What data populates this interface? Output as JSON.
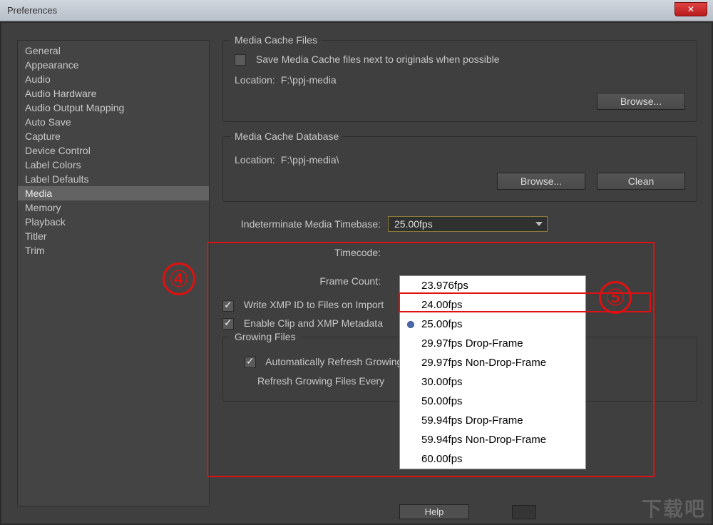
{
  "window": {
    "title": "Preferences"
  },
  "sidebar": {
    "items": [
      "General",
      "Appearance",
      "Audio",
      "Audio Hardware",
      "Audio Output Mapping",
      "Auto Save",
      "Capture",
      "Device Control",
      "Label Colors",
      "Label Defaults",
      "Media",
      "Memory",
      "Playback",
      "Titler",
      "Trim"
    ],
    "selected_index": 10
  },
  "media_cache_files": {
    "title": "Media Cache Files",
    "save_next_label": "Save Media Cache files next to originals when possible",
    "save_next_checked": false,
    "location_label": "Location:",
    "location_value": "F:\\ppj-media",
    "browse_label": "Browse..."
  },
  "media_cache_db": {
    "title": "Media Cache Database",
    "location_label": "Location:",
    "location_value": "F:\\ppj-media\\",
    "browse_label": "Browse...",
    "clean_label": "Clean"
  },
  "timebase": {
    "label": "Indeterminate Media Timebase:",
    "value": "25.00fps",
    "options": [
      "23.976fps",
      "24.00fps",
      "25.00fps",
      "29.97fps Drop-Frame",
      "29.97fps Non-Drop-Frame",
      "30.00fps",
      "50.00fps",
      "59.94fps Drop-Frame",
      "59.94fps Non-Drop-Frame",
      "60.00fps"
    ],
    "selected_option_index": 2
  },
  "timecode": {
    "label": "Timecode:"
  },
  "framecount": {
    "label": "Frame Count:"
  },
  "xmp_write": {
    "label": "Write XMP ID to Files on Import",
    "checked": true
  },
  "xmp_link": {
    "label": "Enable Clip and XMP Metadata",
    "checked": true
  },
  "growing": {
    "title": "Growing Files",
    "auto_refresh_label": "Automatically Refresh Growing Files",
    "auto_refresh_checked": true,
    "refresh_every_label": "Refresh Growing Files Every"
  },
  "help_label": "Help",
  "annotations": {
    "four": "④",
    "five": "⑤"
  },
  "watermark": "下载吧"
}
